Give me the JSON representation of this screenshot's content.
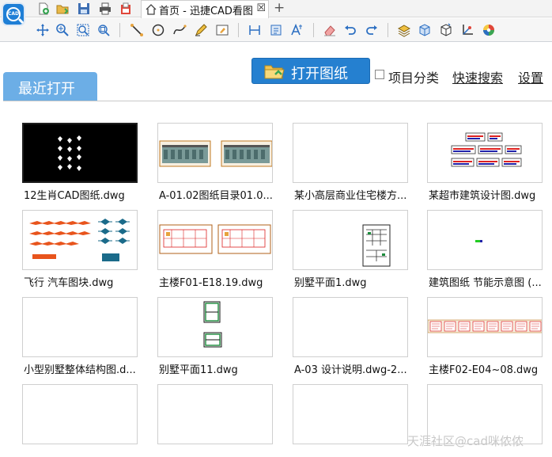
{
  "app": {
    "logo_text": "CAD"
  },
  "tabs": [
    {
      "title": "首页 - 迅捷CAD看图",
      "close": "☒"
    }
  ],
  "new_tab": "+",
  "actions": {
    "open_button": "打开图纸",
    "classify_label": "项目分类",
    "classify_checked": false,
    "quick_search": "快速搜索",
    "settings": "设置"
  },
  "section": {
    "recent_tab": "最近打开"
  },
  "files": [
    {
      "name": "12生肖CAD图纸.dwg",
      "preview": "zodiac"
    },
    {
      "name": "A-01.02图纸目录01.0...",
      "preview": "elevations"
    },
    {
      "name": "某小高层商业住宅楼方...",
      "preview": "blank"
    },
    {
      "name": "某超市建筑设计图.dwg",
      "preview": "supermarket"
    },
    {
      "name": "飞行 汽车图块.dwg",
      "preview": "vehicles"
    },
    {
      "name": "主楼F01-E18.19.dwg",
      "preview": "floorplans"
    },
    {
      "name": "别墅平面1.dwg",
      "preview": "villa1"
    },
    {
      "name": "建筑图纸 节能示意图 (...",
      "preview": "dot"
    },
    {
      "name": "小型别墅整体结构图.d...",
      "preview": "blank"
    },
    {
      "name": "别墅平面11.dwg",
      "preview": "villa11"
    },
    {
      "name": "A-03 设计说明.dwg-2...",
      "preview": "blank"
    },
    {
      "name": "主楼F02-E04~08.dwg",
      "preview": "strip"
    },
    {
      "name": "",
      "preview": "blank"
    },
    {
      "name": "",
      "preview": "blank"
    },
    {
      "name": "",
      "preview": "blank"
    },
    {
      "name": "",
      "preview": "blank"
    }
  ],
  "watermark": "天涯社区@cad咪侬侬"
}
